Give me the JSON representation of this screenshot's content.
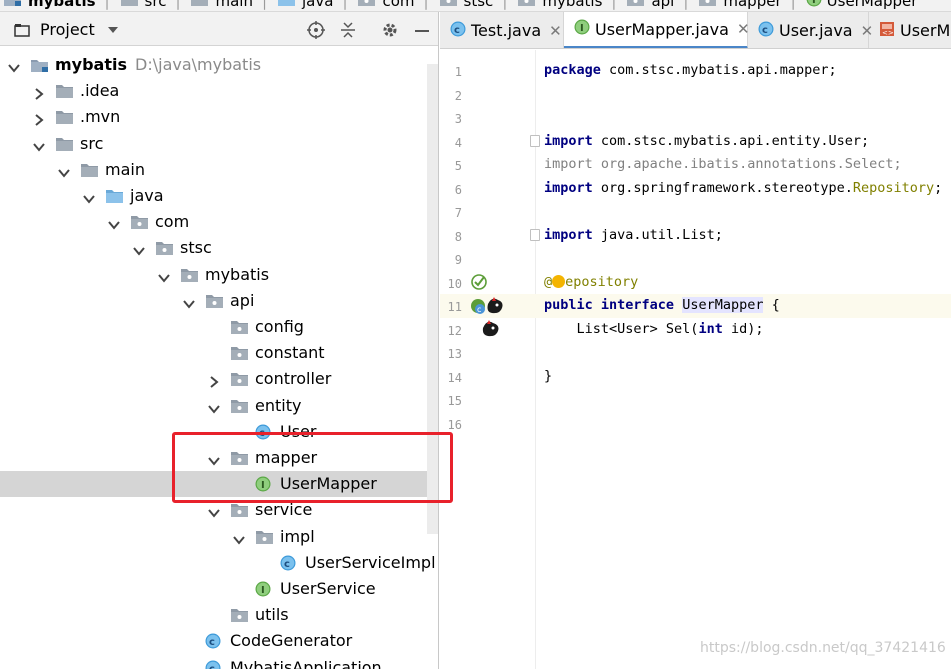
{
  "breadcrumb": [
    {
      "label": "mybatis",
      "icon": "module-folder-icon"
    },
    {
      "label": "src",
      "icon": "folder-icon"
    },
    {
      "label": "main",
      "icon": "folder-icon"
    },
    {
      "label": "java",
      "icon": "source-folder-icon"
    },
    {
      "label": "com",
      "icon": "package-icon"
    },
    {
      "label": "stsc",
      "icon": "package-icon"
    },
    {
      "label": "mybatis",
      "icon": "package-icon"
    },
    {
      "label": "api",
      "icon": "package-icon"
    },
    {
      "label": "mapper",
      "icon": "package-icon"
    },
    {
      "label": "UserMapper",
      "icon": "interface-icon"
    }
  ],
  "project_panel": {
    "title": "Project",
    "tree": [
      {
        "label": "mybatis",
        "path": "D:\\java\\mybatis",
        "icon": "module-folder-icon",
        "expanded": true
      },
      {
        "label": ".idea",
        "icon": "folder-icon",
        "expanded": false
      },
      {
        "label": ".mvn",
        "icon": "folder-icon",
        "expanded": false
      },
      {
        "label": "src",
        "icon": "folder-icon",
        "expanded": true
      },
      {
        "label": "main",
        "icon": "folder-icon",
        "expanded": true
      },
      {
        "label": "java",
        "icon": "source-folder-icon",
        "expanded": true
      },
      {
        "label": "com",
        "icon": "package-icon",
        "expanded": true
      },
      {
        "label": "stsc",
        "icon": "package-icon",
        "expanded": true
      },
      {
        "label": "mybatis",
        "icon": "package-icon",
        "expanded": true
      },
      {
        "label": "api",
        "icon": "package-icon",
        "expanded": true
      },
      {
        "label": "config",
        "icon": "package-icon"
      },
      {
        "label": "constant",
        "icon": "package-icon"
      },
      {
        "label": "controller",
        "icon": "package-icon",
        "expanded": false
      },
      {
        "label": "entity",
        "icon": "package-icon",
        "expanded": true
      },
      {
        "label": "User",
        "icon": "class-icon"
      },
      {
        "label": "mapper",
        "icon": "package-icon",
        "expanded": true
      },
      {
        "label": "UserMapper",
        "icon": "interface-icon",
        "selected": true
      },
      {
        "label": "service",
        "icon": "package-icon",
        "expanded": true
      },
      {
        "label": "impl",
        "icon": "package-icon",
        "expanded": true
      },
      {
        "label": "UserServiceImpl",
        "icon": "class-icon"
      },
      {
        "label": "UserService",
        "icon": "interface-icon"
      },
      {
        "label": "utils",
        "icon": "package-icon"
      },
      {
        "label": "CodeGenerator",
        "icon": "class-icon"
      },
      {
        "label": "MybatisApplication",
        "icon": "class-icon"
      }
    ]
  },
  "tabs": [
    {
      "label": "Test.java",
      "icon": "class-icon",
      "active": false
    },
    {
      "label": "UserMapper.java",
      "icon": "interface-icon",
      "active": true
    },
    {
      "label": "User.java",
      "icon": "class-icon",
      "active": false
    },
    {
      "label": "UserM",
      "icon": "xml-file-icon",
      "active": false
    }
  ],
  "editor": {
    "line_numbers": [
      "1",
      "2",
      "3",
      "4",
      "5",
      "6",
      "7",
      "8",
      "9",
      "10",
      "11",
      "12",
      "13",
      "14",
      "15",
      "16"
    ],
    "code": {
      "l1_kw": "package",
      "l1_rest": " com.stsc.mybatis.api.mapper;",
      "l4_kw": "import",
      "l4_rest": " com.stsc.mybatis.api.entity.User;",
      "l5": "import org.apache.ibatis.annotations.Select;",
      "l6_kw": "import",
      "l6_a": " org.springframework.stereotype.",
      "l6_b": "Repository",
      "l6_c": ";",
      "l8_kw": "import",
      "l8_rest": " java.util.List;",
      "l10_a": "@",
      "l10_b": "epository",
      "l11_kw": "public interface",
      "l11_sp": " ",
      "l11_name": "UserMapper",
      "l11_rest": " {",
      "l12_a": "    List<User> Sel(",
      "l12_kw": "int",
      "l12_b": " id);",
      "l14": "}"
    }
  },
  "watermark": "https://blog.csdn.net/qq_37421416"
}
